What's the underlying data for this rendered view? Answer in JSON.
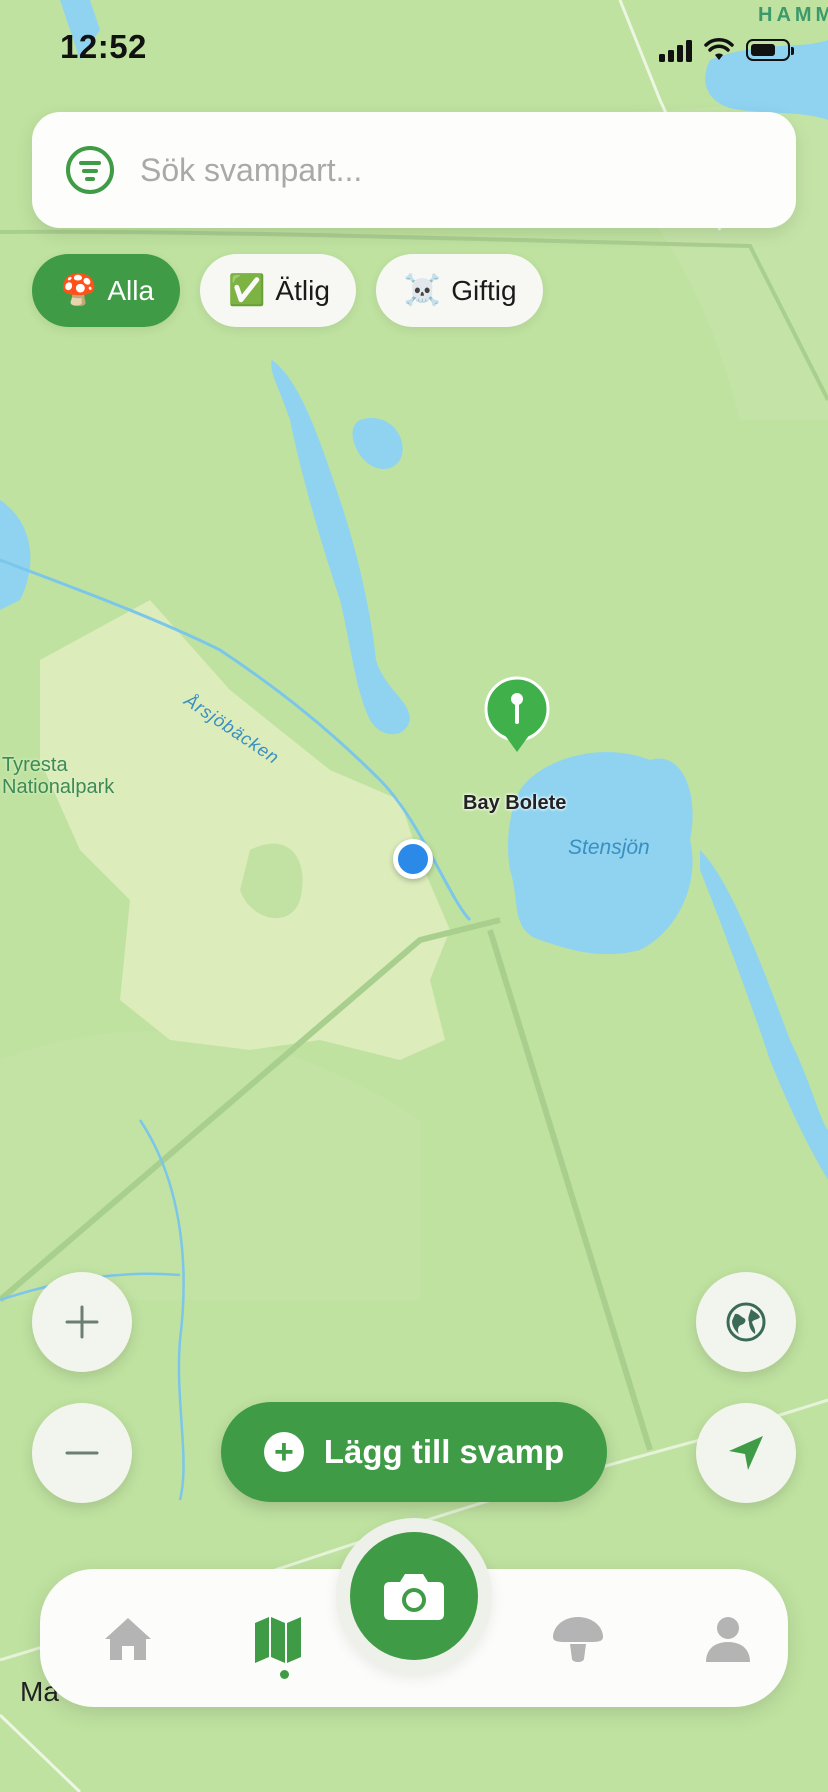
{
  "status_bar": {
    "time": "12:52"
  },
  "search": {
    "placeholder": "Sök svampart...",
    "value": ""
  },
  "filters": [
    {
      "emoji": "🍄",
      "label": "Alla",
      "active": true
    },
    {
      "emoji": "✅",
      "label": "Ätlig",
      "active": false
    },
    {
      "emoji": "☠️",
      "label": "Giftig",
      "active": false
    }
  ],
  "map": {
    "labels": {
      "top_right": "HAMM",
      "creek": "Årsjöbäcken",
      "park": "Tyresta\nNationalpark",
      "lake": "Stensjön",
      "pin": "Bay Bolete"
    },
    "attribution": " Ma"
  },
  "actions": {
    "add_label": "Lägg till svamp"
  },
  "tabs": [
    {
      "icon": "home-icon",
      "active": false
    },
    {
      "icon": "map-icon",
      "active": true
    },
    {
      "icon": "camera-icon",
      "active": false
    },
    {
      "icon": "mushroom-icon",
      "active": false
    },
    {
      "icon": "profile-icon",
      "active": false
    }
  ],
  "colors": {
    "accent": "#3f9b45",
    "water": "#8fd3f0",
    "land": "#bfe2a0",
    "park": "#dcecbb"
  }
}
